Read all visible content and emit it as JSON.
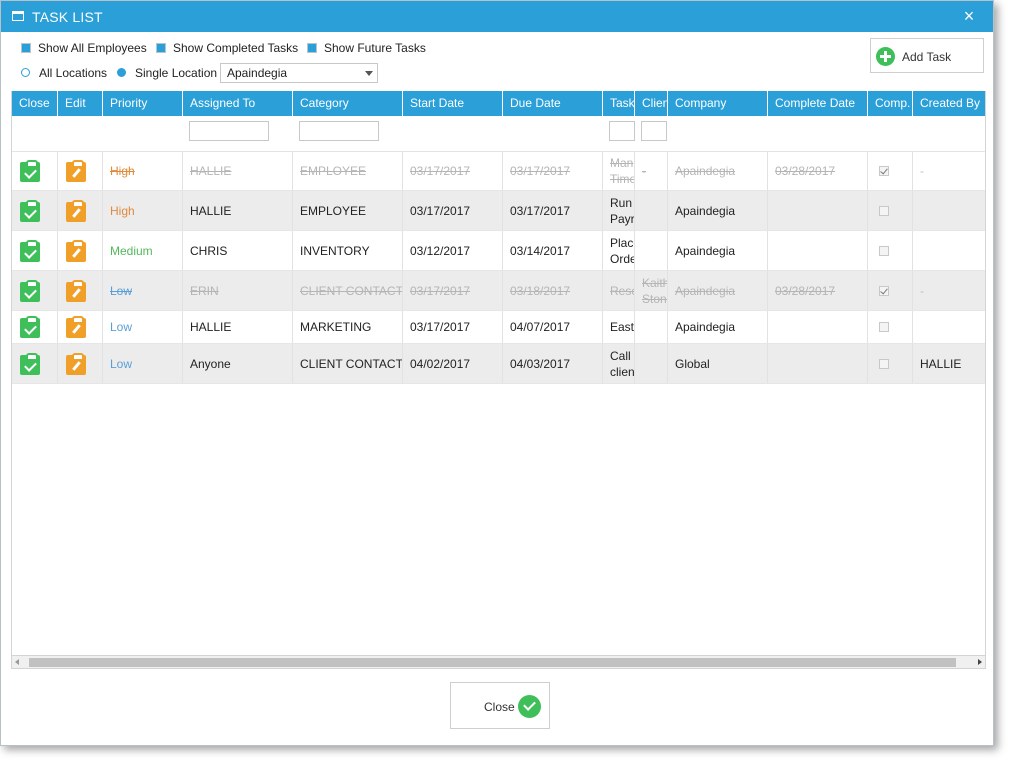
{
  "window": {
    "title": "TASK LIST",
    "close_glyph": "×"
  },
  "options": {
    "show_all_employees": "Show All Employees",
    "show_completed_tasks": "Show Completed Tasks",
    "show_future_tasks": "Show Future Tasks",
    "all_locations": "All Locations",
    "single_location": "Single Location",
    "location_selected": "Apaindegia"
  },
  "toolbar": {
    "add_task_label": "Add Task"
  },
  "table": {
    "headers": [
      "Close",
      "Edit",
      "Priority",
      "Assigned To",
      "Category",
      "Start Date",
      "Due Date",
      "Task",
      "Client",
      "Company",
      "Complete Date",
      "Comp.",
      "Created By"
    ],
    "rows": [
      {
        "priority": "High",
        "assigned_to": "HALLIE",
        "category": "EMPLOYEE",
        "start_date": "03/17/2017",
        "due_date": "03/17/2017",
        "task": "Man Time",
        "client": "-",
        "company": "Apaindegia",
        "complete_date": "03/28/2017",
        "comp": true,
        "created_by": "-",
        "completed": true
      },
      {
        "priority": "High",
        "assigned_to": "HALLIE",
        "category": "EMPLOYEE",
        "start_date": "03/17/2017",
        "due_date": "03/17/2017",
        "task": "Run Payr",
        "client": "",
        "company": "Apaindegia",
        "complete_date": "",
        "comp": false,
        "created_by": "",
        "completed": false
      },
      {
        "priority": "Medium",
        "assigned_to": "CHRIS",
        "category": "INVENTORY",
        "start_date": "03/12/2017",
        "due_date": "03/14/2017",
        "task": "Place Orde",
        "client": "",
        "company": "Apaindegia",
        "complete_date": "",
        "comp": false,
        "created_by": "",
        "completed": false
      },
      {
        "priority": "Low",
        "assigned_to": "ERIN",
        "category": "CLIENT CONTACT",
        "start_date": "03/17/2017",
        "due_date": "03/18/2017",
        "task": "Resc",
        "client": "Kaith Stone",
        "company": "Apaindegia",
        "complete_date": "03/28/2017",
        "comp": true,
        "created_by": "-",
        "completed": true
      },
      {
        "priority": "Low",
        "assigned_to": "HALLIE",
        "category": "MARKETING",
        "start_date": "03/17/2017",
        "due_date": "04/07/2017",
        "task": "Easte",
        "client": "",
        "company": "Apaindegia",
        "complete_date": "",
        "comp": false,
        "created_by": "",
        "completed": false
      },
      {
        "priority": "Low",
        "assigned_to": "Anyone",
        "category": "CLIENT CONTACT",
        "start_date": "04/02/2017",
        "due_date": "04/03/2017",
        "task": "Call clien",
        "client": "",
        "company": "Global",
        "complete_date": "",
        "comp": false,
        "created_by": "HALLIE",
        "completed": false
      }
    ]
  },
  "footer": {
    "close_label": "Close"
  },
  "colors": {
    "accent": "#2a9fd8",
    "success": "#3fbf5a",
    "warning": "#f0a028",
    "priority_high": "#e08a3c",
    "priority_medium": "#52b85a",
    "priority_low": "#5a9fd8"
  },
  "icons": {
    "close_task": "clipboard-check-icon",
    "edit_task": "clipboard-edit-icon",
    "add": "plus-circle-icon",
    "ok": "check-circle-icon",
    "window": "window-icon"
  }
}
